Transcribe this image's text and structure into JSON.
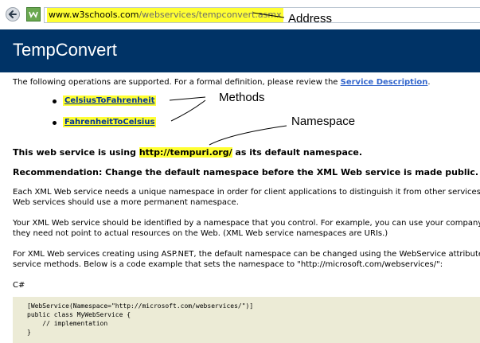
{
  "browser": {
    "url_domain": "www.w3schools.com",
    "url_path": "/webservices/tempconvert.asmx"
  },
  "annotations": {
    "address": "Address",
    "methods": "Methods",
    "namespace": "Namespace"
  },
  "page": {
    "title": "TempConvert",
    "intro_prefix": "The following operations are supported. For a formal definition, please review the ",
    "service_description_link": "Service Description",
    "intro_suffix": ".",
    "methods": [
      "CelsiusToFahrenheit",
      "FahrenheitToCelsius"
    ],
    "namespace_prefix": "This web service is using ",
    "namespace_value": "http://tempuri.org/",
    "namespace_suffix": " as its default namespace.",
    "recommendation": "Recommendation: Change the default namespace before the XML Web service is made public.",
    "para1_line1": "Each XML Web service needs a unique namespace in order for client applications to distinguish it from other services or",
    "para1_line2": "Web services should use a more permanent namespace.",
    "para2_line1": "Your XML Web service should be identified by a namespace that you control. For example, you can use your company's",
    "para2_line2": "they need not point to actual resources on the Web. (XML Web service namespaces are URIs.)",
    "para3_line1": "For XML Web services creating using ASP.NET, the default namespace can be changed using the WebService attribute's",
    "para3_line2": "service methods. Below is a code example that sets the namespace to \"http://microsoft.com/webservices/\":",
    "code_language": "C#",
    "code_lines": [
      "[WebService(Namespace=\"http://microsoft.com/webservices/\")]",
      "public class MyWebService {",
      "    // implementation",
      "}"
    ]
  }
}
